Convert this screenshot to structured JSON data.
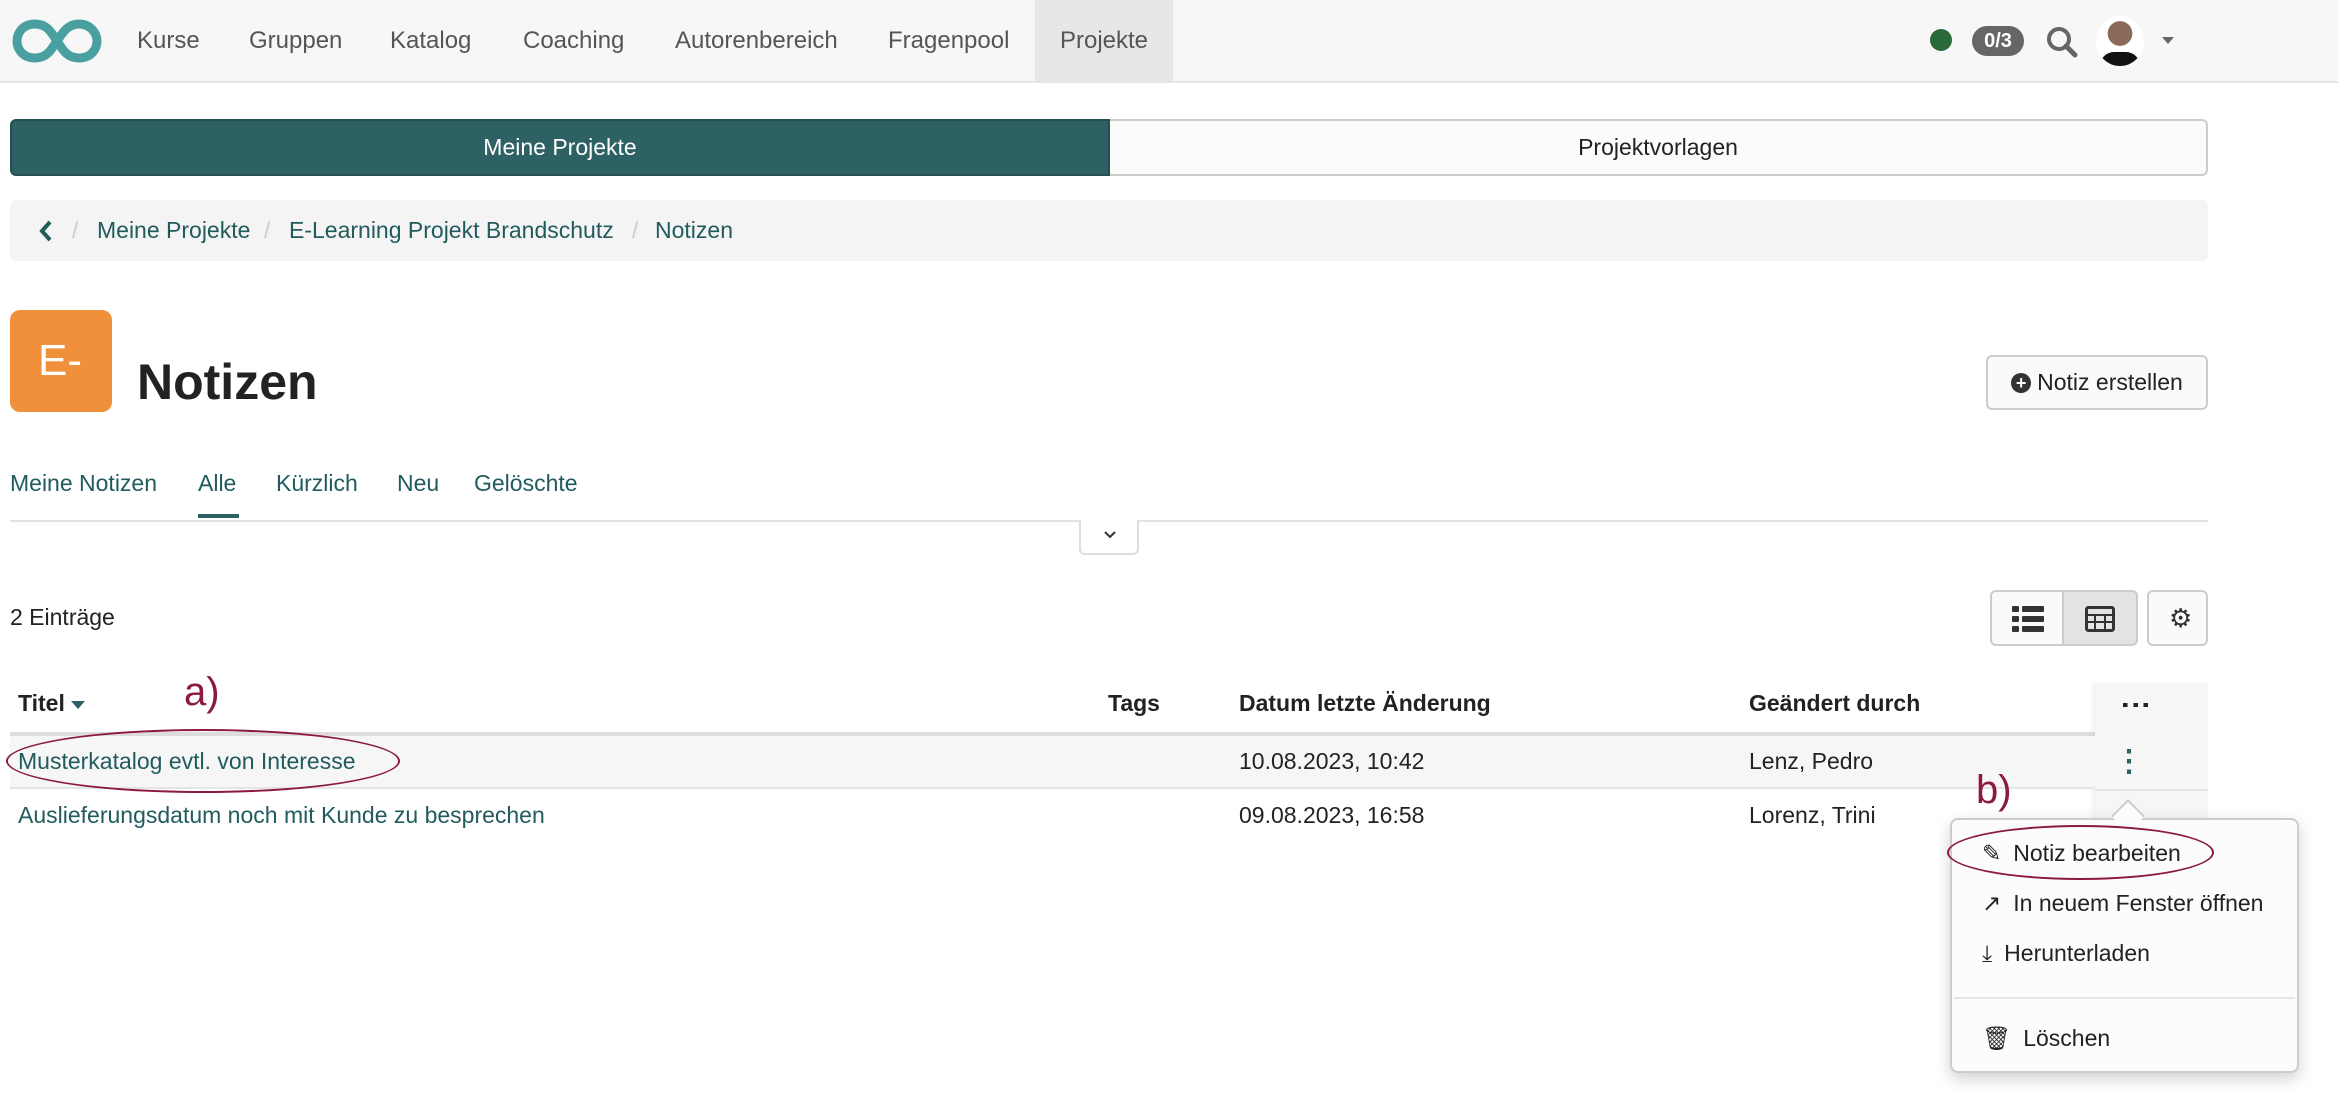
{
  "nav": {
    "items": [
      "Kurse",
      "Gruppen",
      "Katalog",
      "Coaching",
      "Autorenbereich",
      "Fragenpool",
      "Projekte"
    ],
    "active": "Projekte",
    "badge": "0/3",
    "status_color": "#2a6a3a"
  },
  "segments": {
    "left": "Meine Projekte",
    "right": "Projektvorlagen"
  },
  "breadcrumb": [
    "Meine Projekte",
    "E-Learning Projekt Brandschutz",
    "Notizen"
  ],
  "header": {
    "icon_text": "E-",
    "icon_color": "#f0903a",
    "title": "Notizen",
    "create_label": "Notiz erstellen"
  },
  "tabs": [
    "Meine Notizen",
    "Alle",
    "Kürzlich",
    "Neu",
    "Gelöschte"
  ],
  "active_tab": "Alle",
  "count": "2 Einträge",
  "table": {
    "columns": [
      "Titel",
      "Tags",
      "Datum letzte Änderung",
      "Geändert durch"
    ],
    "rows": [
      {
        "title": "Musterkatalog evtl. von Interesse",
        "tags": "",
        "date": "10.08.2023, 10:42",
        "by": "Lenz, Pedro"
      },
      {
        "title": "Auslieferungsdatum noch mit Kunde zu besprechen",
        "tags": "",
        "date": "09.08.2023, 16:58",
        "by": "Lorenz, Trini"
      }
    ]
  },
  "menu": [
    "Notiz bearbeiten",
    "In neuem Fenster öffnen",
    "Herunterladen",
    "Löschen"
  ],
  "annotations": {
    "a": "a)",
    "b": "b)"
  },
  "accent": "#2d6163"
}
